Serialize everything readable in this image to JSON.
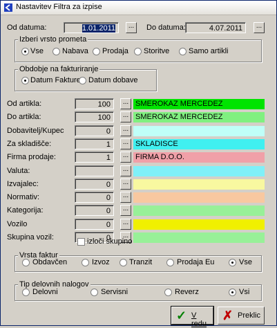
{
  "window": {
    "title": "Nastavitev Filtra za izpise"
  },
  "dates": {
    "from_label": "Od datuma:",
    "from_value": "1.01.2011",
    "to_label": "Do datuma:",
    "to_value": "4.07.2011",
    "button": "..."
  },
  "promet": {
    "title": "Izberi vrsto prometa",
    "options": [
      "Vse",
      "Nabava",
      "Prodaja",
      "Storitve",
      "Samo artikli"
    ],
    "selected": "Vse"
  },
  "obdobje": {
    "title": "Obdobje na fakturiranje",
    "options": [
      "Datum Fakture",
      "Datum dobave"
    ],
    "selected": "Datum Fakture"
  },
  "rows": [
    {
      "label": "Od artikla:",
      "value": "100",
      "text": "SMEROKAZ MERCEDEZ",
      "color": "#00e400"
    },
    {
      "label": "Do artikla:",
      "value": "100",
      "text": "SMEROKAZ MERCEDEZ",
      "color": "#80f080"
    },
    {
      "label": "Dobavitelj/Kupec",
      "value": "0",
      "text": "",
      "color": "#c0fff8"
    },
    {
      "label": "Za skladišče:",
      "value": "1",
      "text": "SKLADISCE",
      "color": "#40f0f0"
    },
    {
      "label": "Firma prodaje:",
      "value": "1",
      "text": "FIRMA D.O.O.",
      "color": "#f0a0a8"
    },
    {
      "label": "Valuta:",
      "value": "",
      "text": "",
      "color": "#80f0f8"
    },
    {
      "label": "Izvajalec:",
      "value": "0",
      "text": "",
      "color": "#f8f8a0"
    },
    {
      "label": "Normativ:",
      "value": "0",
      "text": "",
      "color": "#f8c8a0"
    },
    {
      "label": "Kategorija:",
      "value": "0",
      "text": "",
      "color": "#98f098"
    },
    {
      "label": "Vozilo",
      "value": "0",
      "text": "",
      "color": "#f0f000"
    },
    {
      "label": "Skupina vozil:",
      "value": "0",
      "text": "",
      "color": "#98f098"
    }
  ],
  "izloci": {
    "label": "izloči skupino",
    "checked": false
  },
  "faktur": {
    "title": "Vrsta faktur",
    "options": [
      "Obdavčen",
      "Izvoz",
      "Tranzit",
      "Prodaja Eu",
      "Vse"
    ],
    "selected": "Vse"
  },
  "nalogi": {
    "title": "Tip delovnih nalogov",
    "options": [
      "Delovni",
      "Servisni",
      "Reverz",
      "Vsi"
    ],
    "selected": "Vsi"
  },
  "buttons": {
    "ok": "V redu",
    "cancel": "Preklic"
  },
  "icons": {
    "ok": "check-icon",
    "cancel": "cross-icon"
  }
}
